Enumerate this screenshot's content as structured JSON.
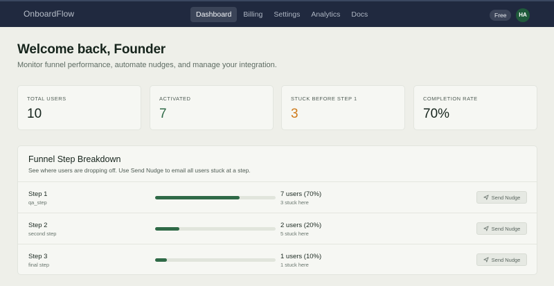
{
  "header": {
    "brand": "OnboardFlow",
    "nav": [
      {
        "label": "Dashboard",
        "active": true
      },
      {
        "label": "Billing",
        "active": false
      },
      {
        "label": "Settings",
        "active": false
      },
      {
        "label": "Analytics",
        "active": false
      },
      {
        "label": "Docs",
        "active": false
      }
    ],
    "plan_badge": "Free",
    "avatar_initials": "HA"
  },
  "page": {
    "title": "Welcome back, Founder",
    "subtitle": "Monitor funnel performance, automate nudges, and manage your integration."
  },
  "stats": [
    {
      "label": "TOTAL USERS",
      "value": "10",
      "color": "#16241c"
    },
    {
      "label": "ACTIVATED",
      "value": "7",
      "color": "#2f6a47"
    },
    {
      "label": "STUCK BEFORE STEP 1",
      "value": "3",
      "color": "#cf7a1b"
    },
    {
      "label": "COMPLETION RATE",
      "value": "70%",
      "color": "#16241c"
    }
  ],
  "breakdown": {
    "title": "Funnel Step Breakdown",
    "description": "See where users are dropping off. Use Send Nudge to email all users stuck at a step.",
    "nudge_label": "Send Nudge",
    "steps": [
      {
        "name": "Step 1",
        "key": "qa_step",
        "users": "7 users (70%)",
        "stuck": "3 stuck here",
        "fill_percent": 70
      },
      {
        "name": "Step 2",
        "key": "second step",
        "users": "2 users (20%)",
        "stuck": "5 stuck here",
        "fill_percent": 20
      },
      {
        "name": "Step 3",
        "key": "final step",
        "users": "1 users (10%)",
        "stuck": "1 stuck here",
        "fill_percent": 10
      }
    ]
  },
  "colors": {
    "accent": "#2f6a47",
    "warning": "#cf7a1b",
    "header_bg": "#20293f",
    "page_bg": "#eeefe9"
  }
}
